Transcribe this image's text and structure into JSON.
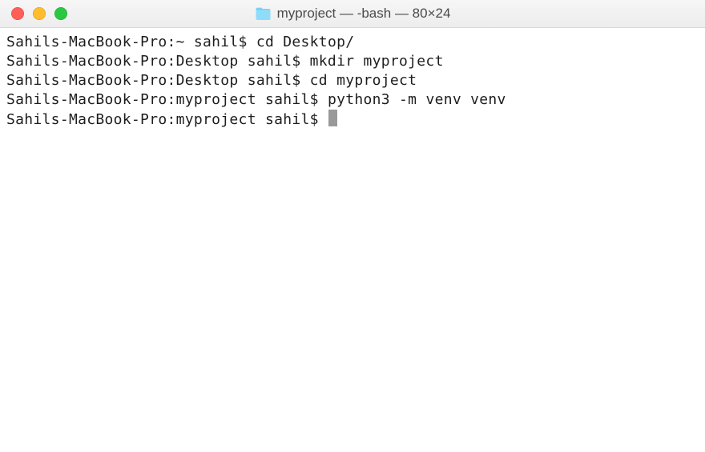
{
  "window": {
    "title": "myproject — -bash — 80×24"
  },
  "terminal": {
    "lines": [
      {
        "prompt": "Sahils-MacBook-Pro:~ sahil$ ",
        "command": "cd Desktop/"
      },
      {
        "prompt": "Sahils-MacBook-Pro:Desktop sahil$ ",
        "command": "mkdir myproject"
      },
      {
        "prompt": "Sahils-MacBook-Pro:Desktop sahil$ ",
        "command": "cd myproject"
      },
      {
        "prompt": "Sahils-MacBook-Pro:myproject sahil$ ",
        "command": "python3 -m venv venv"
      },
      {
        "prompt": "Sahils-MacBook-Pro:myproject sahil$ ",
        "command": ""
      }
    ]
  }
}
